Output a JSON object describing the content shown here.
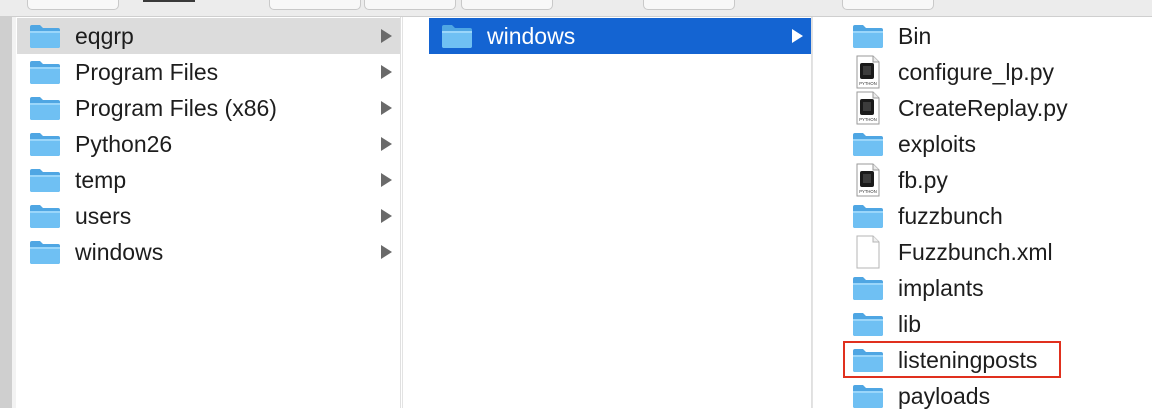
{
  "columns": [
    {
      "items": [
        {
          "label": "eqgrp",
          "type": "folder",
          "has_children": true,
          "state": "selected-gray"
        },
        {
          "label": "Program Files",
          "type": "folder",
          "has_children": true
        },
        {
          "label": "Program Files (x86)",
          "type": "folder",
          "has_children": true
        },
        {
          "label": "Python26",
          "type": "folder",
          "has_children": true
        },
        {
          "label": "temp",
          "type": "folder",
          "has_children": true
        },
        {
          "label": "users",
          "type": "folder",
          "has_children": true
        },
        {
          "label": "windows",
          "type": "folder",
          "has_children": true
        }
      ]
    },
    {
      "items": [
        {
          "label": "windows",
          "type": "folder",
          "has_children": true,
          "state": "selected-blue"
        }
      ]
    },
    {
      "items": [
        {
          "label": "Bin",
          "type": "folder"
        },
        {
          "label": "configure_lp.py",
          "type": "python",
          "icon_text": "PYTHON"
        },
        {
          "label": "CreateReplay.py",
          "type": "python",
          "icon_text": "PYTHON"
        },
        {
          "label": "exploits",
          "type": "folder"
        },
        {
          "label": "fb.py",
          "type": "python",
          "icon_text": "PYTHON"
        },
        {
          "label": "fuzzbunch",
          "type": "folder"
        },
        {
          "label": "Fuzzbunch.xml",
          "type": "document"
        },
        {
          "label": "implants",
          "type": "folder"
        },
        {
          "label": "lib",
          "type": "folder"
        },
        {
          "label": "listeningposts",
          "type": "folder",
          "annotated": true
        },
        {
          "label": "payloads",
          "type": "folder"
        }
      ]
    }
  ],
  "colors": {
    "selection_blue": "#1464d2",
    "selection_gray": "#dcdcdc",
    "folder_blue": "#6fc0f3",
    "annotation_red": "#e0301e"
  }
}
